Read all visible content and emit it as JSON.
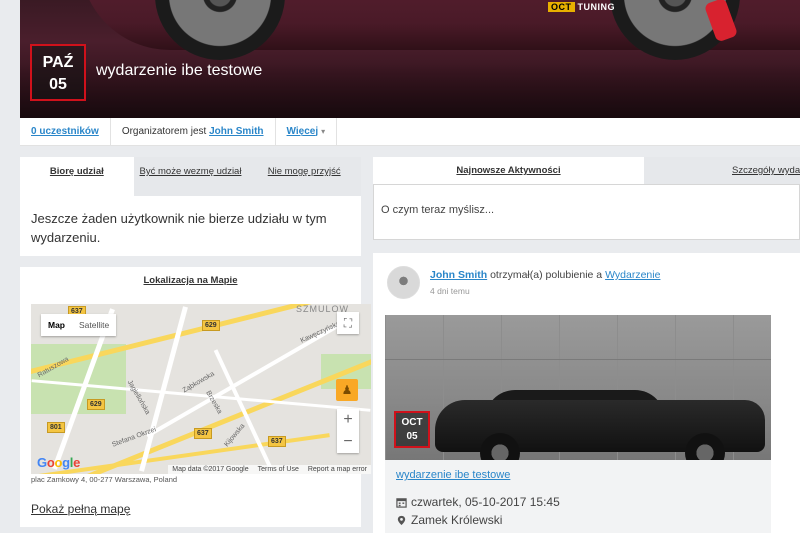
{
  "event": {
    "month": "PAŹ",
    "day": "05",
    "title": "wydarzenie ibe testowe",
    "brand_badge": "OCT",
    "brand_text": "TUNING"
  },
  "info_bar": {
    "participants": "0 uczestników",
    "organizer_prefix": "Organizatorem jest",
    "organizer_name": "John Smith",
    "more": "Więcej"
  },
  "attend_tabs": [
    {
      "label": "Biorę udział",
      "active": true
    },
    {
      "label": "Być może wezmę udział",
      "active": false
    },
    {
      "label": "Nie mogę przyjść",
      "active": false
    }
  ],
  "attend_empty": "Jeszcze żaden użytkownik nie bierze udziału w tym wydarzeniu.",
  "map": {
    "title": "Lokalizacja na Mapie",
    "type_map": "Map",
    "type_satellite": "Satellite",
    "zoom_in": "+",
    "zoom_out": "−",
    "logo": [
      "G",
      "o",
      "o",
      "g",
      "l",
      "e"
    ],
    "attribution": [
      "Map data ©2017 Google",
      "Terms of Use",
      "Report a map error"
    ],
    "shields": [
      "637",
      "629",
      "629",
      "801",
      "637",
      "637"
    ],
    "streets": [
      "Ratuszowa",
      "Kawęczyńska",
      "Ząbkowska",
      "Jagiellońska",
      "Brzeska",
      "Kijowska",
      "Stefana Okrzei",
      "SZMULOW"
    ],
    "address": "plac Zamkowy 4, 00-277 Warszawa, Poland",
    "full_map": "Pokaż pełną mapę"
  },
  "activity_tabs": {
    "latest": "Najnowsze Aktywności",
    "details": "Szczegóły wyda"
  },
  "status": {
    "placeholder": "O czym teraz myślisz..."
  },
  "activity_item": {
    "user": "John Smith",
    "action": "otrzymał(a) polubienie a",
    "target": "Wydarzenie",
    "time": "4 dni temu",
    "badge_month": "OCT",
    "badge_day": "05",
    "event_link": "wydarzenie ibe testowe",
    "datetime": "czwartek, 05-10-2017 15:45",
    "location": "Zamek Królewski"
  }
}
